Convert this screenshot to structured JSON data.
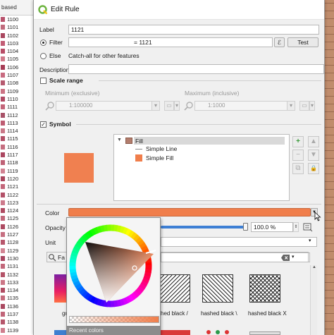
{
  "background_list": {
    "header": "based",
    "rows": [
      "1100",
      "1101",
      "1102",
      "1103",
      "1104",
      "1105",
      "1106",
      "1107",
      "1108",
      "1109",
      "1110",
      "1111",
      "1112",
      "1113",
      "1114",
      "1115",
      "1116",
      "1117",
      "1118",
      "1119",
      "1120",
      "1121",
      "1122",
      "1123",
      "1124",
      "1125",
      "1126",
      "1127",
      "1128",
      "1129",
      "1130",
      "1131",
      "1132",
      "1133",
      "1134",
      "1135",
      "1136",
      "1137",
      "1138",
      "1139"
    ],
    "swatch_colors": [
      "#b8536d",
      "#c06a7c",
      "#a9475f",
      "#c25d75",
      "#b84d67",
      "#d07a8a",
      "#a63b55",
      "#c86b80",
      "#b65a6f",
      "#cc7384",
      "#b04963",
      "#c36479",
      "#a85268",
      "#be5c72",
      "#ca7888",
      "#b24f66",
      "#c56d7f",
      "#ab4660",
      "#bf6276",
      "#d28292",
      "#a9455d",
      "#c3667a",
      "#b35168",
      "#cd7a8b",
      "#b04b62",
      "#c2687b",
      "#ad4a61",
      "#c66f81",
      "#b8576c",
      "#d38594",
      "#a84560",
      "#c2677a",
      "#b45368",
      "#cc7686",
      "#b14c63",
      "#c56b7d",
      "#aa4860",
      "#c16579",
      "#b5566b",
      "#cf7d8d"
    ]
  },
  "dialog": {
    "title": "Edit Rule",
    "label": {
      "caption": "Label",
      "value": "1121"
    },
    "filter": {
      "caption": "Filter",
      "value": "= 1121",
      "expr_button": "ℰ",
      "test_button": "Test"
    },
    "else": {
      "caption": "Else",
      "text": "Catch-all for other features"
    },
    "description": {
      "caption": "Description",
      "value": ""
    },
    "scale_range": {
      "caption": "Scale range",
      "min_caption": "Minimum (exclusive)",
      "min_value": "1:100000",
      "max_caption": "Maximum (inclusive)",
      "max_value": "1:1000"
    },
    "symbol": {
      "caption": "Symbol",
      "check": "✓",
      "tree": [
        {
          "label": "Fill",
          "level": 0
        },
        {
          "label": "Simple Line",
          "level": 1
        },
        {
          "label": "Simple Fill",
          "level": 1
        }
      ],
      "side_buttons": [
        "+",
        "▲",
        "−",
        "▼",
        "⧉",
        "🔒"
      ]
    },
    "color": {
      "caption": "Color",
      "value_hex": "#f07e4b"
    },
    "opacity": {
      "caption": "Opacity",
      "value": "100.0 %",
      "fraction": 1.0
    },
    "unit": {
      "caption": "Unit"
    },
    "search": {
      "value": "Fa",
      "placeholder": ""
    },
    "tiles": [
      {
        "label": "gr"
      },
      {
        "label": "hed black /"
      },
      {
        "label": "hashed black \\"
      },
      {
        "label": "hashed black X"
      }
    ]
  },
  "color_picker": {
    "recent_label": "Recent colors",
    "hue_hex": "#f07e4b"
  },
  "colors": {
    "accent": "#3d7fd4",
    "symbol_fill": "#f08050",
    "fill_swatch": "#b27d6d",
    "qgis_green": "#6cb33e"
  }
}
